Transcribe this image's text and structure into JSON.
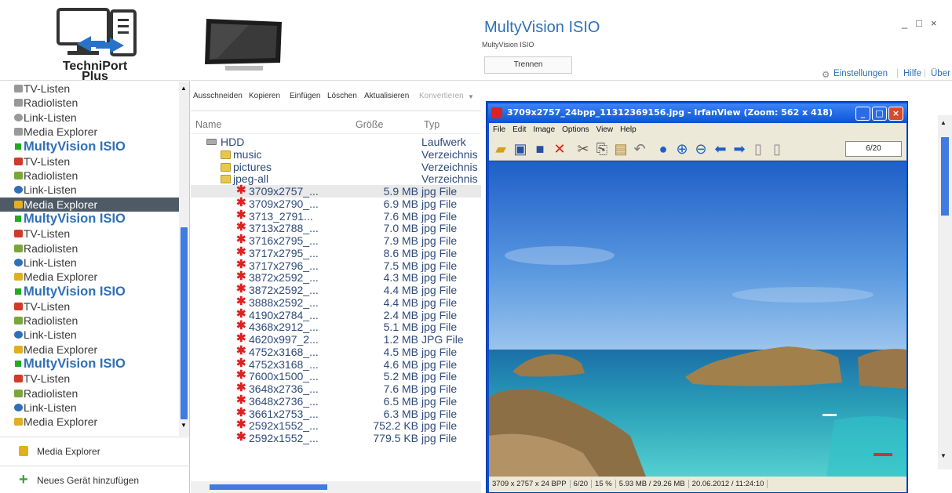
{
  "logo": {
    "line1": "TechniPort",
    "line2": "Plus"
  },
  "sidebar": {
    "top_items": [
      {
        "label": "TV-Listen",
        "icon": "tv-icon"
      },
      {
        "label": "Radiolisten",
        "icon": "radio-icon"
      },
      {
        "label": "Link-Listen",
        "icon": "globe-icon"
      },
      {
        "label": "Media Explorer",
        "icon": "folder-icon"
      }
    ],
    "devices": [
      {
        "name": "MultyVision ISIO",
        "items": [
          "TV-Listen",
          "Radiolisten",
          "Link-Listen",
          "Media Explorer"
        ]
      },
      {
        "name": "MultyVision ISIO",
        "items": [
          "TV-Listen",
          "Radiolisten",
          "Link-Listen",
          "Media Explorer"
        ]
      },
      {
        "name": "MultyVision ISIO",
        "items": [
          "TV-Listen",
          "Radiolisten",
          "Link-Listen",
          "Media Explorer"
        ]
      },
      {
        "name": "MultyVision ISIO",
        "items": [
          "TV-Listen",
          "Radiolisten",
          "Link-Listen",
          "Media Explorer"
        ]
      }
    ],
    "selected": "Media Explorer",
    "bottom_media_explorer": "Media Explorer",
    "add_device": "Neues Gerät hinzufügen"
  },
  "header": {
    "device_title": "MultyVision ISIO",
    "device_subtitle": "MultyVision ISIO",
    "disconnect_button": "Trennen",
    "settings_link": "Einstellungen",
    "help_link": "Hilfe",
    "about_link": "Über",
    "minimize": "_",
    "maximize": "□",
    "close": "×"
  },
  "toolbar": {
    "cut": "Ausschneiden",
    "copy": "Kopieren",
    "paste": "Einfügen",
    "delete": "Löschen",
    "refresh": "Aktualisieren",
    "convert": "Konvertieren"
  },
  "columns": {
    "name": "Name",
    "size": "Größe",
    "type": "Typ"
  },
  "files": [
    {
      "name": "HDD",
      "size": "",
      "type": "Laufwerk",
      "level": 0,
      "kind": "drive"
    },
    {
      "name": "music",
      "size": "",
      "type": "Verzeichnis",
      "level": 1,
      "kind": "folder"
    },
    {
      "name": "pictures",
      "size": "",
      "type": "Verzeichnis",
      "level": 1,
      "kind": "folder"
    },
    {
      "name": "jpeg-all",
      "size": "",
      "type": "Verzeichnis",
      "level": 2,
      "kind": "folder"
    },
    {
      "name": "3709x2757_...",
      "size": "5.9 MB",
      "type": "jpg File",
      "level": 3,
      "kind": "jpg"
    },
    {
      "name": "3709x2790_...",
      "size": "6.9 MB",
      "type": "jpg File",
      "level": 3,
      "kind": "jpg"
    },
    {
      "name": "3713_2791...",
      "size": "7.6 MB",
      "type": "jpg File",
      "level": 3,
      "kind": "jpg"
    },
    {
      "name": "3713x2788_...",
      "size": "7.0 MB",
      "type": "jpg File",
      "level": 3,
      "kind": "jpg"
    },
    {
      "name": "3716x2795_...",
      "size": "7.9 MB",
      "type": "jpg File",
      "level": 3,
      "kind": "jpg"
    },
    {
      "name": "3717x2795_...",
      "size": "8.6 MB",
      "type": "jpg File",
      "level": 3,
      "kind": "jpg"
    },
    {
      "name": "3717x2796_...",
      "size": "7.5 MB",
      "type": "jpg File",
      "level": 3,
      "kind": "jpg"
    },
    {
      "name": "3872x2592_...",
      "size": "4.3 MB",
      "type": "jpg File",
      "level": 3,
      "kind": "jpg"
    },
    {
      "name": "3872x2592_...",
      "size": "4.4 MB",
      "type": "jpg File",
      "level": 3,
      "kind": "jpg"
    },
    {
      "name": "3888x2592_...",
      "size": "4.4 MB",
      "type": "jpg File",
      "level": 3,
      "kind": "jpg"
    },
    {
      "name": "4190x2784_...",
      "size": "2.4 MB",
      "type": "jpg File",
      "level": 3,
      "kind": "jpg"
    },
    {
      "name": "4368x2912_...",
      "size": "5.1 MB",
      "type": "jpg File",
      "level": 3,
      "kind": "jpg"
    },
    {
      "name": "4620x997_2...",
      "size": "1.2 MB",
      "type": "JPG File",
      "level": 3,
      "kind": "jpg"
    },
    {
      "name": "4752x3168_...",
      "size": "4.5 MB",
      "type": "jpg File",
      "level": 3,
      "kind": "jpg"
    },
    {
      "name": "4752x3168_...",
      "size": "4.6 MB",
      "type": "jpg File",
      "level": 3,
      "kind": "jpg"
    },
    {
      "name": "7600x1500_...",
      "size": "5.2 MB",
      "type": "jpg File",
      "level": 3,
      "kind": "jpg"
    },
    {
      "name": "3648x2736_...",
      "size": "7.6 MB",
      "type": "jpg File",
      "level": 3,
      "kind": "jpg"
    },
    {
      "name": "3648x2736_...",
      "size": "6.5 MB",
      "type": "jpg File",
      "level": 3,
      "kind": "jpg"
    },
    {
      "name": "3661x2753_...",
      "size": "6.3 MB",
      "type": "jpg File",
      "level": 3,
      "kind": "jpg"
    },
    {
      "name": "2592x1552_...",
      "size": "752.2 KB",
      "type": "jpg File",
      "level": 3,
      "kind": "jpg"
    },
    {
      "name": "2592x1552_...",
      "size": "779.5 KB",
      "type": "jpg File",
      "level": 3,
      "kind": "jpg"
    }
  ],
  "viewer": {
    "title": "3709x2757_24bpp_11312369156.jpg - IrfanView (Zoom: 562 x 418)",
    "menu": [
      "File",
      "Edit",
      "Image",
      "Options",
      "View",
      "Help"
    ],
    "page_counter": "6/20",
    "status": [
      "3709 x 2757 x 24 BPP",
      "6/20",
      "15 %",
      "5.93 MB / 29.26 MB",
      "20.06.2012 / 11:24:10"
    ]
  },
  "colors": {
    "accent": "#2f6fb7",
    "selection": "#4e5a66",
    "device_square": "#22aa22",
    "scroll_thumb": "#3f7be0",
    "xp_title": "#0d55d6"
  }
}
